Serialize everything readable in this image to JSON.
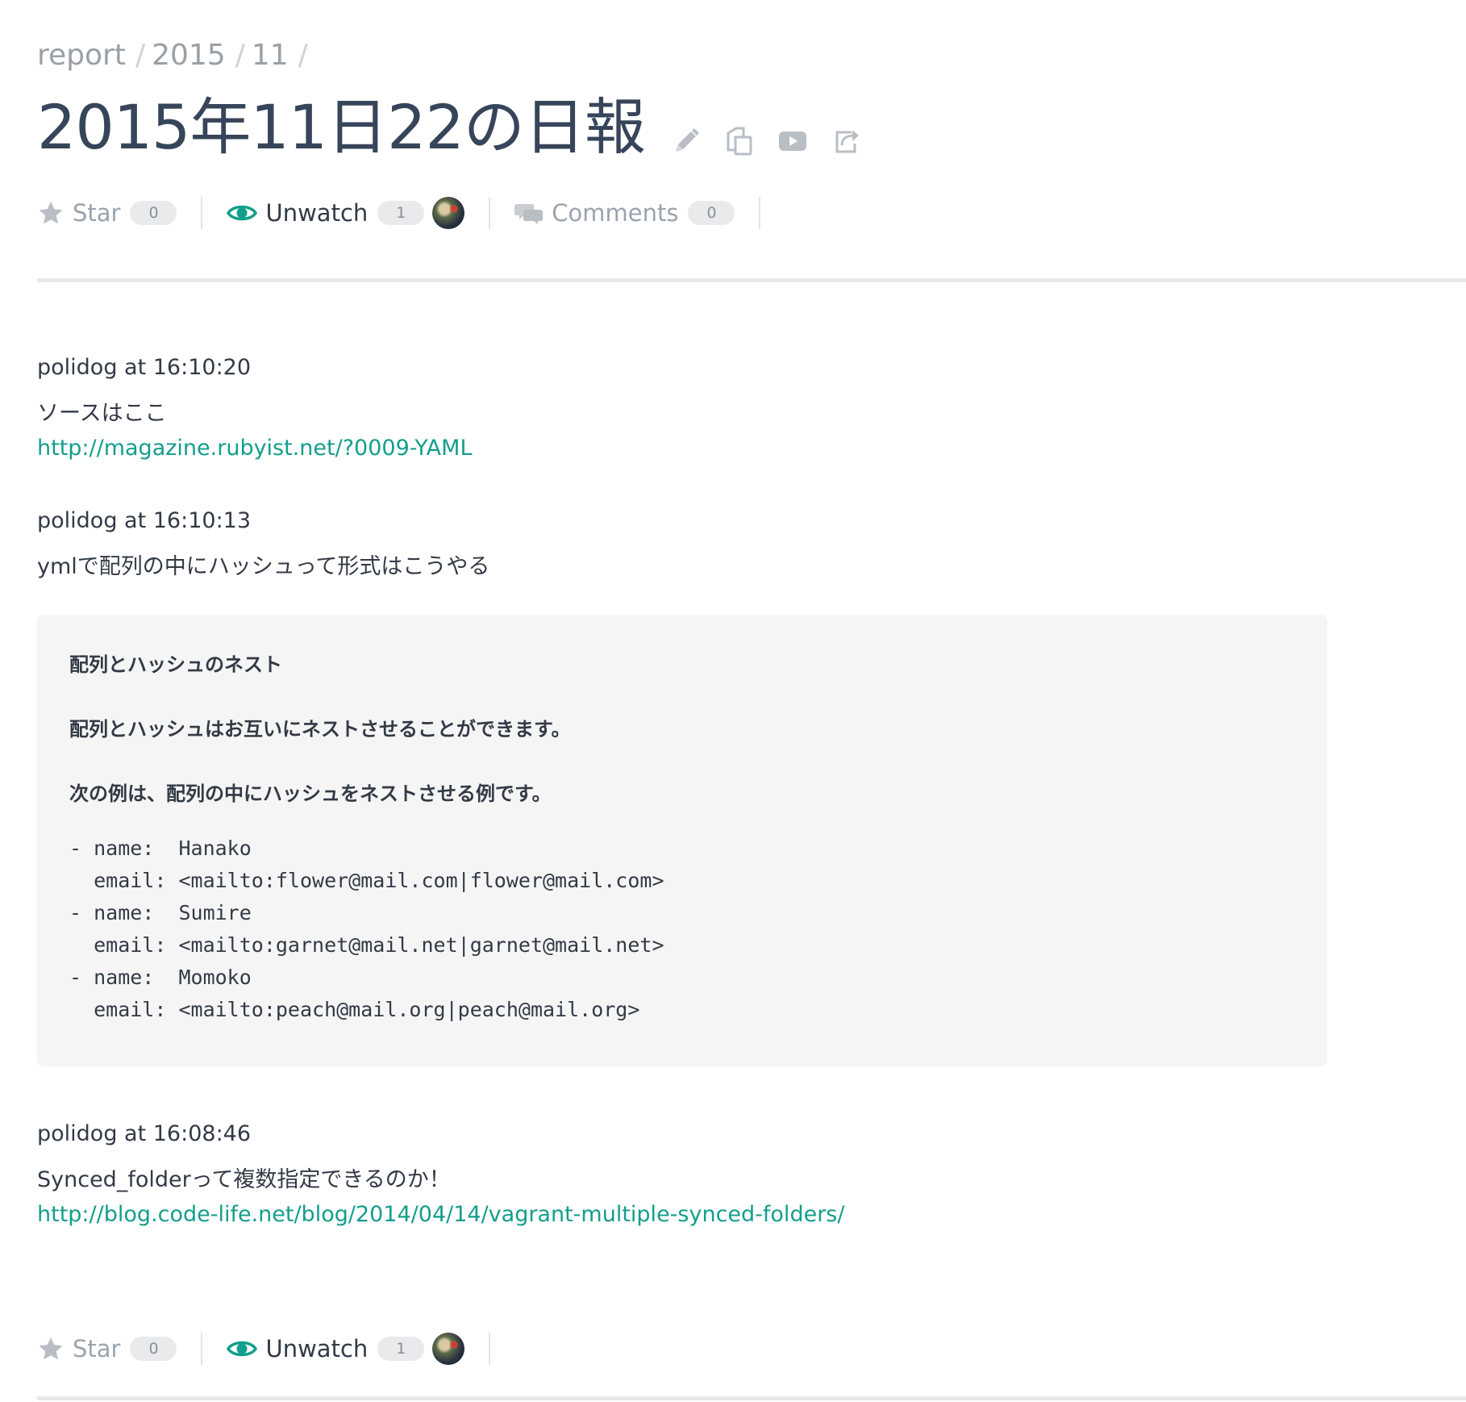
{
  "breadcrumb": [
    "report",
    "2015",
    "11"
  ],
  "breadcrumb_separator": "/",
  "title": "2015年11日22の日報",
  "title_actions": [
    "pencil-icon",
    "copy-icon",
    "play-icon",
    "share-icon"
  ],
  "actions_top": {
    "star_label": "Star",
    "star_count": "0",
    "watch_label": "Unwatch",
    "watch_count": "1",
    "comments_label": "Comments",
    "comments_count": "0"
  },
  "entries": [
    {
      "header": "polidog at 16:10:20",
      "text": "ソースはここ",
      "link": "http://magazine.rubyist.net/?0009-YAML"
    },
    {
      "header": "polidog at 16:10:13",
      "text": "ymlで配列の中にハッシュって形式はこうやる",
      "code": {
        "heading": "配列とハッシュのネスト",
        "para1": "配列とハッシュはお互いにネストさせることができます。",
        "para2": "次の例は、配列の中にハッシュをネストさせる例です。",
        "code": "- name:  Hanako\n  email: <mailto:flower@mail.com|flower@mail.com>\n- name:  Sumire\n  email: <mailto:garnet@mail.net|garnet@mail.net>\n- name:  Momoko\n  email: <mailto:peach@mail.org|peach@mail.org>"
      }
    },
    {
      "header": "polidog at 16:08:46",
      "text": "Synced_folderって複数指定できるのか！",
      "link": "http://blog.code-life.net/blog/2014/04/14/vagrant-multiple-synced-folders/"
    }
  ],
  "actions_bottom": {
    "star_label": "Star",
    "star_count": "0",
    "watch_label": "Unwatch",
    "watch_count": "1"
  },
  "colors": {
    "accent_teal": "#139e8c",
    "title": "#37455a",
    "muted": "#9aa3ad"
  }
}
